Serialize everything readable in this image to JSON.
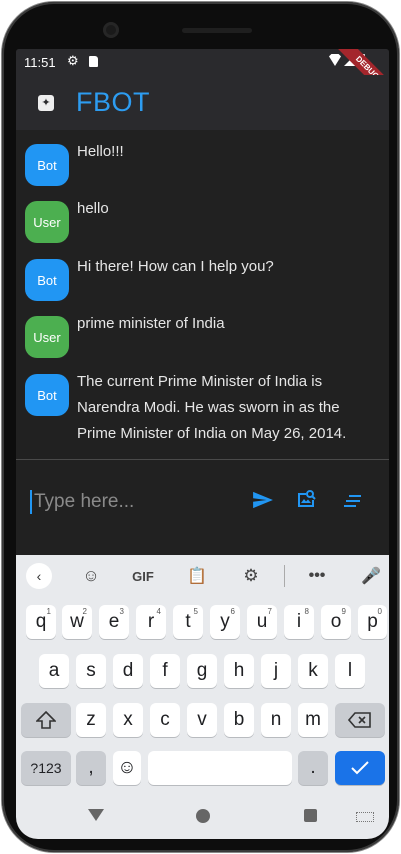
{
  "status_bar": {
    "time": "11:51",
    "debug_banner": "DEBUG"
  },
  "app_bar": {
    "icon": "auto-awesome-icon",
    "title": "FBOT"
  },
  "messages": [
    {
      "sender": "Bot",
      "text": "Hello!!!"
    },
    {
      "sender": "User",
      "text": "hello"
    },
    {
      "sender": "Bot",
      "text": "Hi there! How can I help you?"
    },
    {
      "sender": "User",
      "text": "prime minister of India"
    },
    {
      "sender": "Bot",
      "text": "The current Prime Minister of India is Narendra Modi. He was sworn in as the Prime Minister of India on May 26, 2014."
    }
  ],
  "input": {
    "placeholder": "Type here...",
    "icons": [
      "send-icon",
      "image-search-icon",
      "list-icon"
    ]
  },
  "keyboard": {
    "toolbar": {
      "gif": "GIF"
    },
    "row1": [
      "q",
      "w",
      "e",
      "r",
      "t",
      "y",
      "u",
      "i",
      "o",
      "p"
    ],
    "row1_hints": [
      "1",
      "2",
      "3",
      "4",
      "5",
      "6",
      "7",
      "8",
      "9",
      "0"
    ],
    "row2": [
      "a",
      "s",
      "d",
      "f",
      "g",
      "h",
      "j",
      "k",
      "l"
    ],
    "row3": [
      "z",
      "x",
      "c",
      "v",
      "b",
      "n",
      "m"
    ],
    "symbols_key": "?123",
    "comma_key": ",",
    "period_key": "."
  },
  "colors": {
    "accent": "#2196f3",
    "user_avatar": "#4caf50",
    "background": "#212121",
    "app_bar": "#2a2a2d"
  }
}
